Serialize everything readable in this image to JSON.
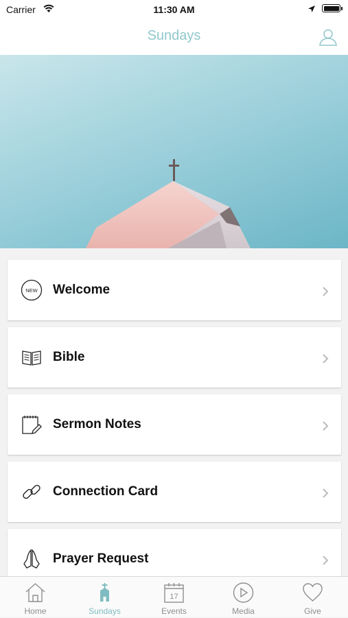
{
  "status_bar": {
    "carrier": "Carrier",
    "time": "11:30 AM"
  },
  "nav": {
    "title": "Sundays",
    "profile_icon": "person-icon"
  },
  "hero": {
    "image": "church-steeple-cross-against-blue-sky"
  },
  "menu_items": [
    {
      "label": "Welcome",
      "icon": "new-badge-icon"
    },
    {
      "label": "Bible",
      "icon": "open-book-icon"
    },
    {
      "label": "Sermon Notes",
      "icon": "notepad-pencil-icon"
    },
    {
      "label": "Connection Card",
      "icon": "link-icon"
    },
    {
      "label": "Prayer Request",
      "icon": "praying-hands-icon"
    }
  ],
  "welcome_badge_text": "NEW",
  "calendar_day": "17",
  "tabs": [
    {
      "label": "Home",
      "icon": "house-icon",
      "active": false
    },
    {
      "label": "Sundays",
      "icon": "church-icon",
      "active": true
    },
    {
      "label": "Events",
      "icon": "calendar-icon",
      "active": false
    },
    {
      "label": "Media",
      "icon": "play-circle-icon",
      "active": false
    },
    {
      "label": "Give",
      "icon": "heart-icon",
      "active": false
    }
  ],
  "colors": {
    "accent": "#7fbcc1",
    "tab_inactive": "#8e8e8e",
    "background": "#f2f2f2"
  }
}
